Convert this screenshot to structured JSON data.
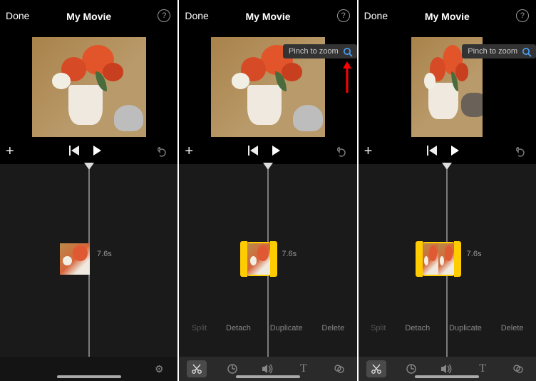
{
  "header": {
    "done": "Done",
    "title": "My Movie",
    "help": "?"
  },
  "tooltip": {
    "text": "Pinch to zoom"
  },
  "clip": {
    "duration": "7.6s"
  },
  "clip_actions": {
    "split": "Split",
    "detach": "Detach",
    "duplicate": "Duplicate",
    "delete": "Delete"
  },
  "toolbar_icons": {
    "scissors": "✂",
    "speed": "◔",
    "volume": "🔊",
    "text": "T",
    "filters": "⬤",
    "settings": "⚙"
  }
}
